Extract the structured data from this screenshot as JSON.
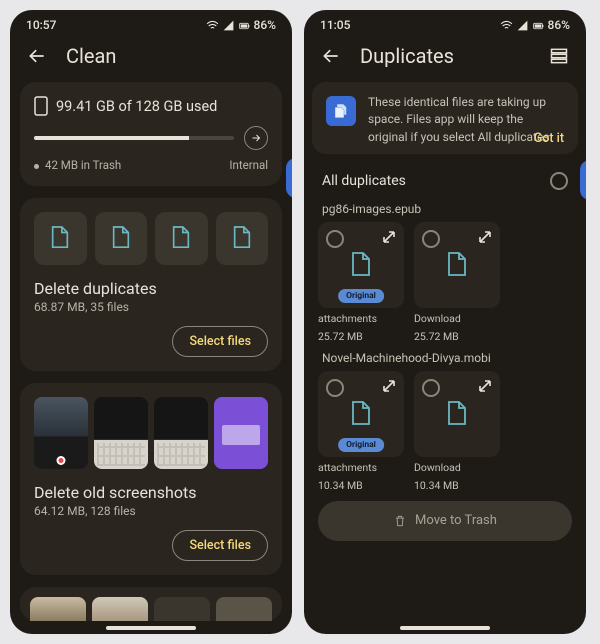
{
  "left": {
    "status": {
      "time": "10:57",
      "battery": "86%"
    },
    "title": "Clean",
    "storage": {
      "used_label": "99.41 GB of 128 GB used",
      "trash_label": "42 MB in Trash",
      "location_label": "Internal",
      "progress_pct": 77.7
    },
    "duplicates": {
      "title": "Delete duplicates",
      "subtitle": "68.87 MB, 35 files",
      "action": "Select files"
    },
    "screenshots": {
      "title": "Delete old screenshots",
      "subtitle": "64.12 MB, 128 files",
      "action": "Select files"
    }
  },
  "right": {
    "status": {
      "time": "11:05",
      "battery": "86%"
    },
    "title": "Duplicates",
    "banner": {
      "text": "These identical files are taking up space. Files app will keep the original if you select All duplicates.",
      "action": "Got it"
    },
    "all_label": "All duplicates",
    "groups": [
      {
        "name": "pg86-images.epub",
        "items": [
          {
            "folder": "attachments",
            "size": "25.72 MB",
            "original": true
          },
          {
            "folder": "Download",
            "size": "25.72 MB",
            "original": false
          }
        ]
      },
      {
        "name": "Novel-Machinehood-Divya.mobi",
        "items": [
          {
            "folder": "attachments",
            "size": "10.34 MB",
            "original": true
          },
          {
            "folder": "Download",
            "size": "10.34 MB",
            "original": false
          }
        ]
      }
    ],
    "trash_label": "Move to Trash"
  }
}
